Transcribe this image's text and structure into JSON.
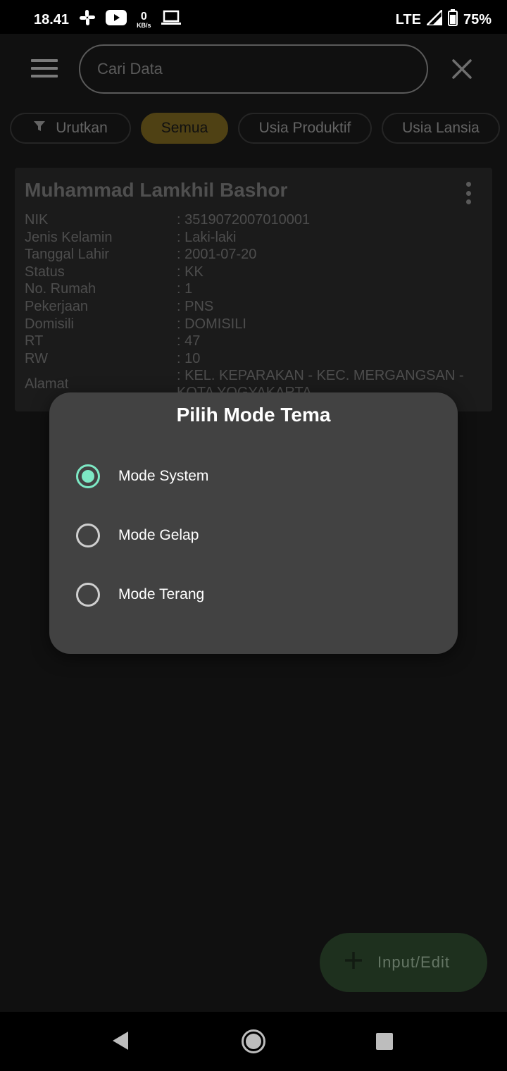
{
  "status_bar": {
    "time": "18.41",
    "net_speed_value": "0",
    "net_speed_unit": "KB/s",
    "network": "LTE",
    "battery": "75%",
    "icons": [
      "slack-icon",
      "youtube-icon",
      "laptop-icon",
      "signal-icon",
      "battery-icon"
    ]
  },
  "appbar": {
    "search_placeholder": "Cari Data"
  },
  "chips": {
    "sort_label": "Urutkan",
    "items": [
      "Semua",
      "Usia Produktif",
      "Usia Lansia"
    ],
    "active": "Semua"
  },
  "card": {
    "name": "Muhammad Lamkhil Bashor",
    "fields": [
      {
        "label": "NIK",
        "value": ": 3519072007010001"
      },
      {
        "label": "Jenis Kelamin",
        "value": ": Laki-laki"
      },
      {
        "label": "Tanggal Lahir",
        "value": ": 2001-07-20"
      },
      {
        "label": "Status",
        "value": ": KK"
      },
      {
        "label": "No. Rumah",
        "value": ": 1"
      },
      {
        "label": "Pekerjaan",
        "value": ": PNS"
      },
      {
        "label": "Domisili",
        "value": ": DOMISILI"
      },
      {
        "label": "RT",
        "value": ": 47"
      },
      {
        "label": "RW",
        "value": ": 10"
      },
      {
        "label": "Alamat",
        "value": ": KEL. KEPARAKAN - KEC. MERGANGSAN - KOTA YOGYAKARTA"
      }
    ]
  },
  "dialog": {
    "title": "Pilih Mode Tema",
    "options": [
      {
        "label": "Mode System",
        "selected": true
      },
      {
        "label": "Mode Gelap",
        "selected": false
      },
      {
        "label": "Mode Terang",
        "selected": false
      }
    ],
    "accent": "#7de8c4"
  },
  "fab": {
    "label": "Input/Edit"
  },
  "colors": {
    "background": "#191919",
    "dialog": "#424242",
    "chip_active": "#7a6420",
    "fab": "#2f4a2f"
  }
}
